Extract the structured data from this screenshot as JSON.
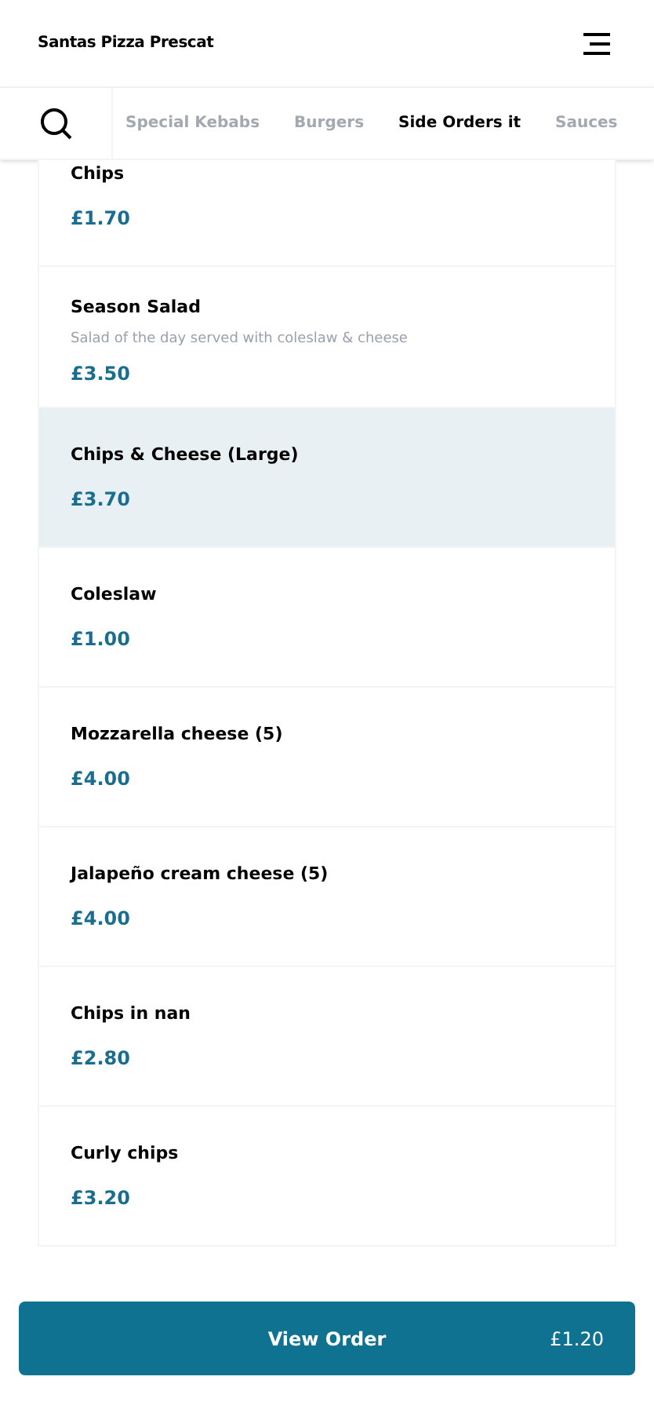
{
  "header": {
    "title": "Santas Pizza Prescat"
  },
  "tabs": [
    {
      "label": "Special Kebabs",
      "selected": false
    },
    {
      "label": "Burgers",
      "selected": false
    },
    {
      "label": "Side Orders it",
      "selected": true
    },
    {
      "label": "Sauces",
      "selected": false
    }
  ],
  "items": [
    {
      "name": "Chips",
      "price": "£1.70",
      "selected": false
    },
    {
      "name": "Season Salad",
      "description": "Salad of the day served with coleslaw & cheese",
      "price": "£3.50",
      "selected": false
    },
    {
      "name": "Chips & Cheese (Large)",
      "price": "£3.70",
      "selected": true
    },
    {
      "name": "Coleslaw",
      "price": "£1.00",
      "selected": false
    },
    {
      "name": "Mozzarella cheese (5)",
      "price": "£4.00",
      "selected": false
    },
    {
      "name": "Jalapeño cream cheese (5)",
      "price": "£4.00",
      "selected": false
    },
    {
      "name": "Chips in nan",
      "price": "£2.80",
      "selected": false
    },
    {
      "name": "Curly chips",
      "price": "£3.20",
      "selected": false
    }
  ],
  "order_button": {
    "label": "View Order",
    "total": "£1.20"
  }
}
